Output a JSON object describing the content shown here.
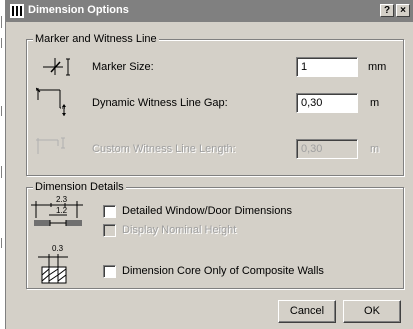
{
  "window": {
    "title": "Dimension Options",
    "help_label": "?",
    "close_label": "×"
  },
  "marker_group": {
    "legend": "Marker and Witness Line",
    "rows": [
      {
        "label": "Marker Size:",
        "value": "1",
        "unit": "mm",
        "enabled": true
      },
      {
        "label": "Dynamic Witness Line Gap:",
        "value": "0,30",
        "unit": "m",
        "enabled": true
      },
      {
        "label": "Custom Witness Line Length:",
        "value": "0,30",
        "unit": "m",
        "enabled": false
      }
    ]
  },
  "details_group": {
    "legend": "Dimension Details",
    "icon1_top": "2.3",
    "icon1_bottom": "1.2",
    "icon2_top": "0.3",
    "options": [
      {
        "label": "Detailed Window/Door Dimensions",
        "checked": false,
        "enabled": true
      },
      {
        "label": "Display Nominal Height",
        "checked": false,
        "enabled": false
      },
      {
        "label": "Dimension Core Only of Composite Walls",
        "checked": false,
        "enabled": true
      }
    ]
  },
  "buttons": {
    "cancel": "Cancel",
    "ok": "OK"
  }
}
